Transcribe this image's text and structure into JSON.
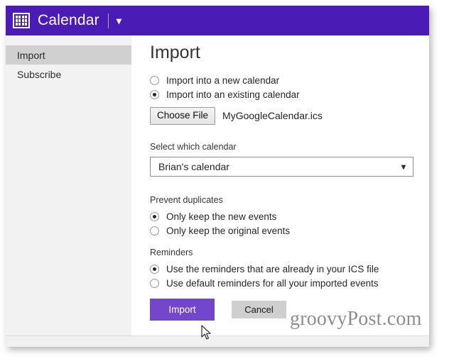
{
  "window": {
    "titlebar": {
      "icon": "calendar-icon",
      "title": "Calendar",
      "dropdown_icon": "chevron-down-icon",
      "background_color": "#4b1bb5"
    }
  },
  "sidebar": {
    "items": [
      {
        "label": "Import",
        "selected": true
      },
      {
        "label": "Subscribe",
        "selected": false
      }
    ]
  },
  "main": {
    "heading": "Import",
    "import_mode": {
      "options": [
        {
          "label": "Import into a new calendar",
          "selected": false
        },
        {
          "label": "Import into an existing calendar",
          "selected": true
        }
      ]
    },
    "file_picker": {
      "button_label": "Choose File",
      "file_name": "MyGoogleCalendar.ics"
    },
    "calendar_select": {
      "label": "Select which calendar",
      "value": "Brian's calendar",
      "chevron_icon": "chevron-down-icon"
    },
    "prevent_duplicates": {
      "label": "Prevent duplicates",
      "options": [
        {
          "label": "Only keep the new events",
          "selected": true
        },
        {
          "label": "Only keep the original events",
          "selected": false
        }
      ]
    },
    "reminders": {
      "label": "Reminders",
      "options": [
        {
          "label": "Use the reminders that are already in your ICS file",
          "selected": true
        },
        {
          "label": "Use default reminders for all your imported events",
          "selected": false
        }
      ]
    },
    "actions": {
      "primary_label": "Import",
      "secondary_label": "Cancel",
      "primary_color": "#7346cc",
      "secondary_color": "#cfcfcf"
    }
  },
  "watermark": {
    "text": "groovyPost.com"
  }
}
